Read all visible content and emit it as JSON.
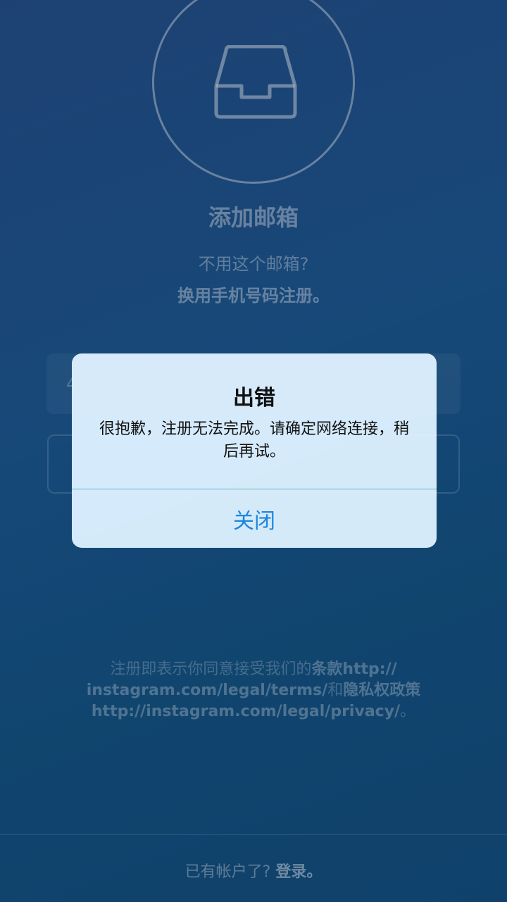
{
  "header": {
    "icon": "inbox-tray-icon",
    "title": "添加邮箱",
    "subtitle": "不用这个邮箱?",
    "switch_link": "换用手机号码注册。"
  },
  "form": {
    "email_value": "4",
    "next_label": ""
  },
  "terms": {
    "line1_prefix": "注册即表示你同意接受我们的",
    "terms_label": "条款http://",
    "line2_link": "instagram.com/legal/terms/",
    "line2_middle": "和",
    "privacy_label": "隐私权政策",
    "line3_link": "http://instagram.com/legal/privacy/",
    "line3_suffix": "。"
  },
  "footer": {
    "prompt": "已有帐户了?",
    "login_label": "登录。"
  },
  "alert": {
    "title": "出错",
    "message": "很抱歉，注册无法完成。请确定网络连接，稍后再试。",
    "close_label": "关闭"
  },
  "colors": {
    "accent": "#1d86e0",
    "divider": "#5fb7cc"
  }
}
